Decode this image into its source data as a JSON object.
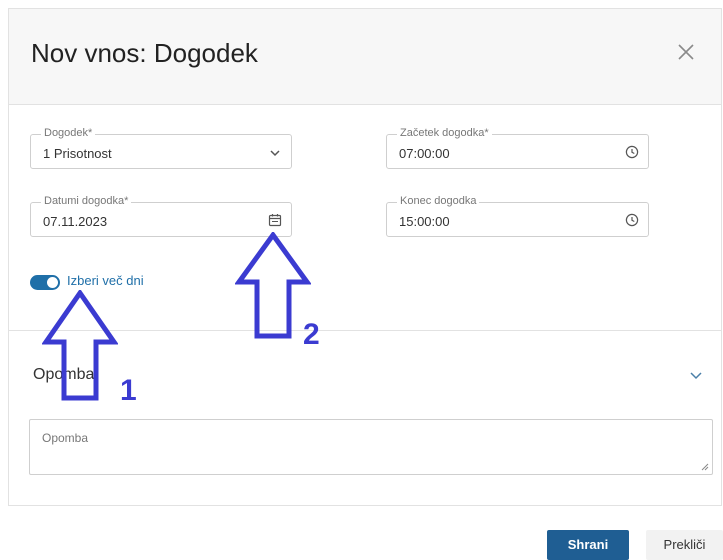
{
  "dialog": {
    "title": "Nov vnos: Dogodek",
    "close_icon": "close-icon"
  },
  "form": {
    "event_type": {
      "label": "Dogodek*",
      "value": "1 Prisotnost",
      "icon": "chevron-down-icon"
    },
    "start_time": {
      "label": "Začetek dogodka*",
      "value": "07:00:00",
      "icon": "clock-icon"
    },
    "event_date": {
      "label": "Datumi dogodka*",
      "value": "07.11.2023",
      "icon": "calendar-icon"
    },
    "end_time": {
      "label": "Konec dogodka",
      "value": "15:00:00",
      "icon": "clock-icon"
    },
    "multi_day_toggle": {
      "label": "Izberi več dni",
      "on": true
    }
  },
  "note_section": {
    "title": "Opomba",
    "placeholder": "Opomba",
    "icon": "chevron-down-icon"
  },
  "buttons": {
    "save": "Shrani",
    "cancel": "Prekliči"
  },
  "annotations": {
    "arrow1_label": "1",
    "arrow2_label": "2",
    "color": "#3b3bd1"
  },
  "colors": {
    "accent": "#1f6fa8",
    "primary_button": "#1f5e93"
  }
}
